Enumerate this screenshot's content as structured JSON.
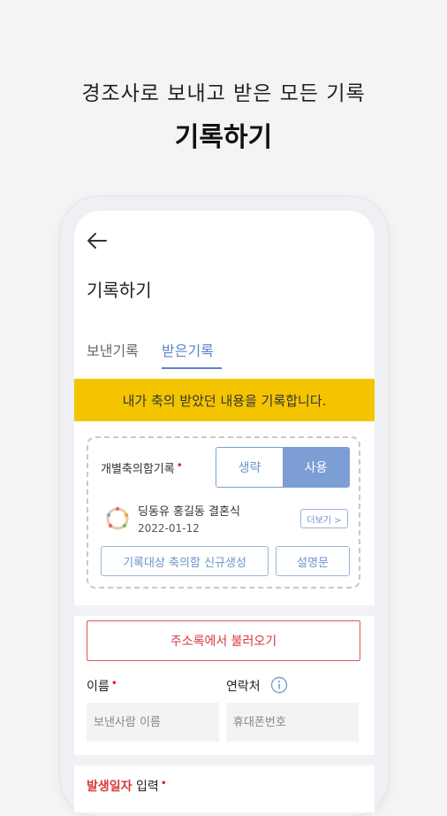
{
  "headline": "경조사로 보내고 받은 모든 기록",
  "headline_bold": "기록하기",
  "screen": {
    "title": "기록하기",
    "tabs": [
      {
        "label": "보낸기록",
        "active": false
      },
      {
        "label": "받은기록",
        "active": true
      }
    ],
    "banner": "내가 축의 받았던 내용을 기록합니다.",
    "gift_box": {
      "label": "개별축의함기록",
      "toggle_off": "생략",
      "toggle_on": "사용",
      "event_name": "딩동유 홍길동 결혼식",
      "event_date": "2022-01-12",
      "more_label": "더보기 >",
      "new_button": "기록대상 축의함 신규생성",
      "desc_button": "설명문"
    },
    "address_button": "주소록에서 불러오기",
    "name_label": "이름",
    "contact_label": "연락처",
    "name_placeholder": "보낸사람 이름",
    "phone_placeholder": "휴대폰번호",
    "date_label_red": "발생일자",
    "date_label_rest": " 입력"
  },
  "colors": {
    "accent_blue": "#7d9ed4",
    "banner_yellow": "#f5c400",
    "red": "#d83a3a"
  }
}
